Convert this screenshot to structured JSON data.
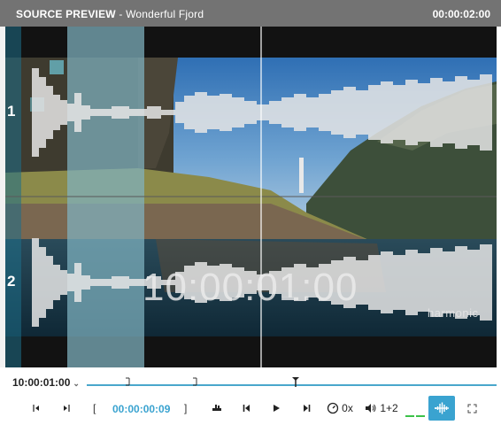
{
  "titlebar": {
    "label": "SOURCE PREVIEW",
    "clip_name": " - Wonderful Fjord",
    "timecode": "00:00:02:00"
  },
  "preview": {
    "channel_1": "1",
    "channel_2": "2",
    "burned_timecode": "10:00:01:00",
    "watermark": "harmonic"
  },
  "timeline": {
    "position_timecode": "10:00:01:00",
    "playhead_fraction": 0.51
  },
  "transport": {
    "in_point_timecode": "00:00:00:09",
    "speed": "0x",
    "channel_map": "1+2"
  },
  "colors": {
    "accent": "#3aa3d0",
    "titlebar": "#737373",
    "selection": "#7fb3c0"
  },
  "icons": [
    "step-back-icon",
    "step-forward-icon",
    "in-bracket-icon",
    "out-bracket-icon",
    "trim-icon",
    "go-to-start-icon",
    "play-icon",
    "go-to-end-icon",
    "speed-gauge-icon",
    "volume-icon",
    "audio-meter-icon",
    "waveform-icon",
    "fullscreen-icon"
  ]
}
